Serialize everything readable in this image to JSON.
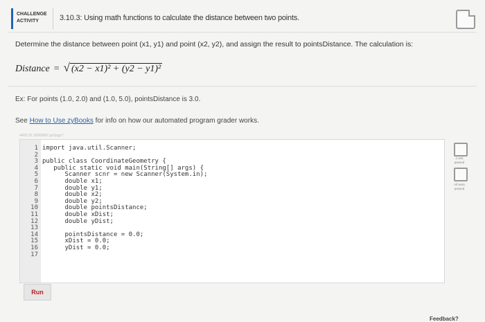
{
  "header": {
    "tag_line1": "CHALLENGE",
    "tag_line2": "ACTIVITY",
    "title": "3.10.3: Using math functions to calculate the distance between two points."
  },
  "problem": {
    "description": "Determine the distance between point (x1, y1) and point (x2, y2), and assign the result to pointsDistance. The calculation is:",
    "formula_lhs": "Distance",
    "formula_eq": "=",
    "formula_radical": "√",
    "formula_rhs": "(x2 − x1)² + (y2 − y1)²",
    "example": "Ex: For points (1.0, 2.0) and (1.0, 5.0), pointsDistance is 3.0.",
    "see_prefix": "See ",
    "see_link": "How to Use zyBooks",
    "see_suffix": " for info on how our automated program grader works."
  },
  "editor": {
    "meta_id": "449176.3295800.qx3zqy7",
    "lines": [
      {
        "n": "1",
        "text": "import java.util.Scanner;"
      },
      {
        "n": "2",
        "text": ""
      },
      {
        "n": "3",
        "text": "public class CoordinateGeometry {"
      },
      {
        "n": "4",
        "text": "   public static void main(String[] args) {"
      },
      {
        "n": "5",
        "text": "      Scanner scnr = new Scanner(System.in);"
      },
      {
        "n": "6",
        "text": "      double x1;"
      },
      {
        "n": "7",
        "text": "      double y1;"
      },
      {
        "n": "8",
        "text": "      double x2;"
      },
      {
        "n": "9",
        "text": "      double y2;"
      },
      {
        "n": "10",
        "text": "      double pointsDistance;"
      },
      {
        "n": "11",
        "text": "      double xDist;"
      },
      {
        "n": "12",
        "text": "      double yDist;"
      },
      {
        "n": "13",
        "text": ""
      },
      {
        "n": "14",
        "text": "      pointsDistance = 0.0;"
      },
      {
        "n": "15",
        "text": "      xDist = 0.0;"
      },
      {
        "n": "16",
        "text": "      yDist = 0.0;"
      },
      {
        "n": "17",
        "text": ""
      }
    ]
  },
  "run_label": "Run",
  "tests": {
    "test1_line1": "1 test",
    "test1_line2": "passed",
    "all_line1": "All tests",
    "all_line2": "passed"
  },
  "feedback_label": "Feedback?"
}
